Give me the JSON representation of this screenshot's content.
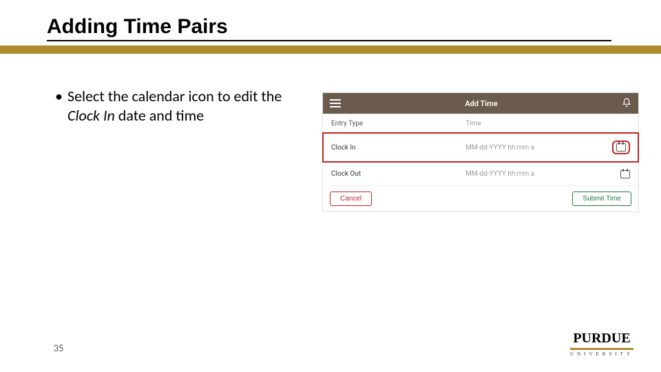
{
  "slide": {
    "title": "Adding Time Pairs",
    "bullet_prefix": "Select the calendar icon to edit the ",
    "bullet_italic": "Clock In",
    "bullet_suffix": " date and time",
    "page_number": "35"
  },
  "app": {
    "header_title": "Add Time",
    "col_entry_type": "Entry Type",
    "col_time": "Time",
    "rows": [
      {
        "label": "Clock In",
        "placeholder": "MM-dd-YYYY hh:mm a"
      },
      {
        "label": "Clock Out",
        "placeholder": "MM-dd-YYYY hh:mm a"
      }
    ],
    "cancel": "Cancel",
    "submit": "Submit Time"
  },
  "logo": {
    "top": "PURDUE",
    "bottom": "UNIVERSITY"
  }
}
